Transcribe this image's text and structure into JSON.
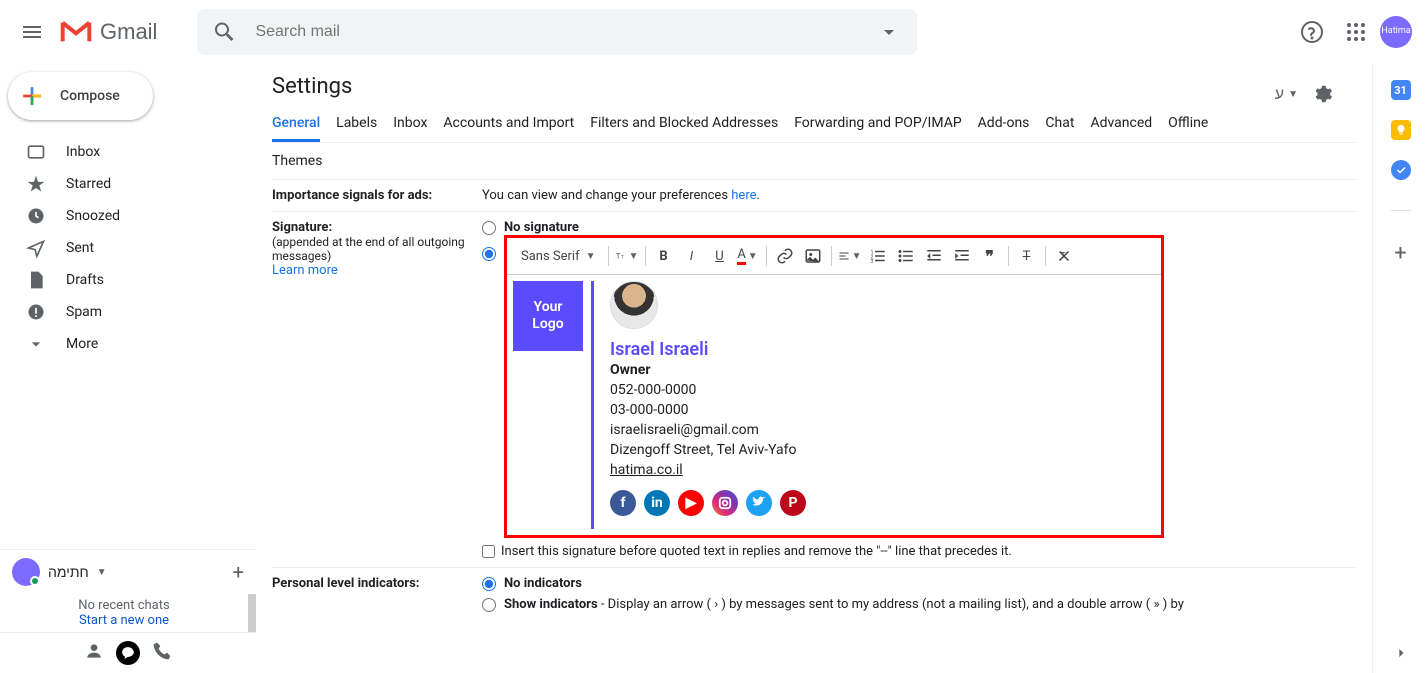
{
  "header": {
    "logo_text": "Gmail",
    "search_placeholder": "Search mail"
  },
  "sidebar": {
    "compose": "Compose",
    "items": [
      {
        "label": "Inbox"
      },
      {
        "label": "Starred"
      },
      {
        "label": "Snoozed"
      },
      {
        "label": "Sent"
      },
      {
        "label": "Drafts"
      },
      {
        "label": "Spam"
      },
      {
        "label": "More"
      }
    ]
  },
  "hangouts": {
    "name": "חתימה",
    "no_recent": "No recent chats",
    "start_new": "Start a new one"
  },
  "settings": {
    "title": "Settings",
    "tabs": [
      "General",
      "Labels",
      "Inbox",
      "Accounts and Import",
      "Filters and Blocked Addresses",
      "Forwarding and POP/IMAP",
      "Add-ons",
      "Chat",
      "Advanced",
      "Offline"
    ],
    "themes_tab": "Themes",
    "lang_indicator": "ע"
  },
  "section_importance": {
    "label": "Importance signals for ads:",
    "text_pre": "You can view and change your preferences ",
    "link": "here",
    "text_post": "."
  },
  "section_signature": {
    "label": "Signature:",
    "sub": "(appended at the end of all outgoing messages)",
    "learn": "Learn more",
    "no_sig": "No signature",
    "font_name": "Sans Serif",
    "insert_checkbox": "Insert this signature before quoted text in replies and remove the \"--\" line that precedes it."
  },
  "signature_data": {
    "logo_text": "Your Logo",
    "name": "Israel Israeli",
    "title": "Owner",
    "phone1": "052-000-0000",
    "phone2": "03-000-0000",
    "email": "israelisraeli@gmail.com",
    "address": "Dizengoff Street, Tel Aviv-Yafo",
    "website": "hatima.co.il"
  },
  "section_personal": {
    "label": "Personal level indicators:",
    "no_indicators": "No indicators",
    "show_label": "Show indicators",
    "show_text": " - Display an arrow ( › ) by messages sent to my address (not a mailing list), and a double arrow ( » ) by"
  },
  "avatar_text": "Hatima"
}
